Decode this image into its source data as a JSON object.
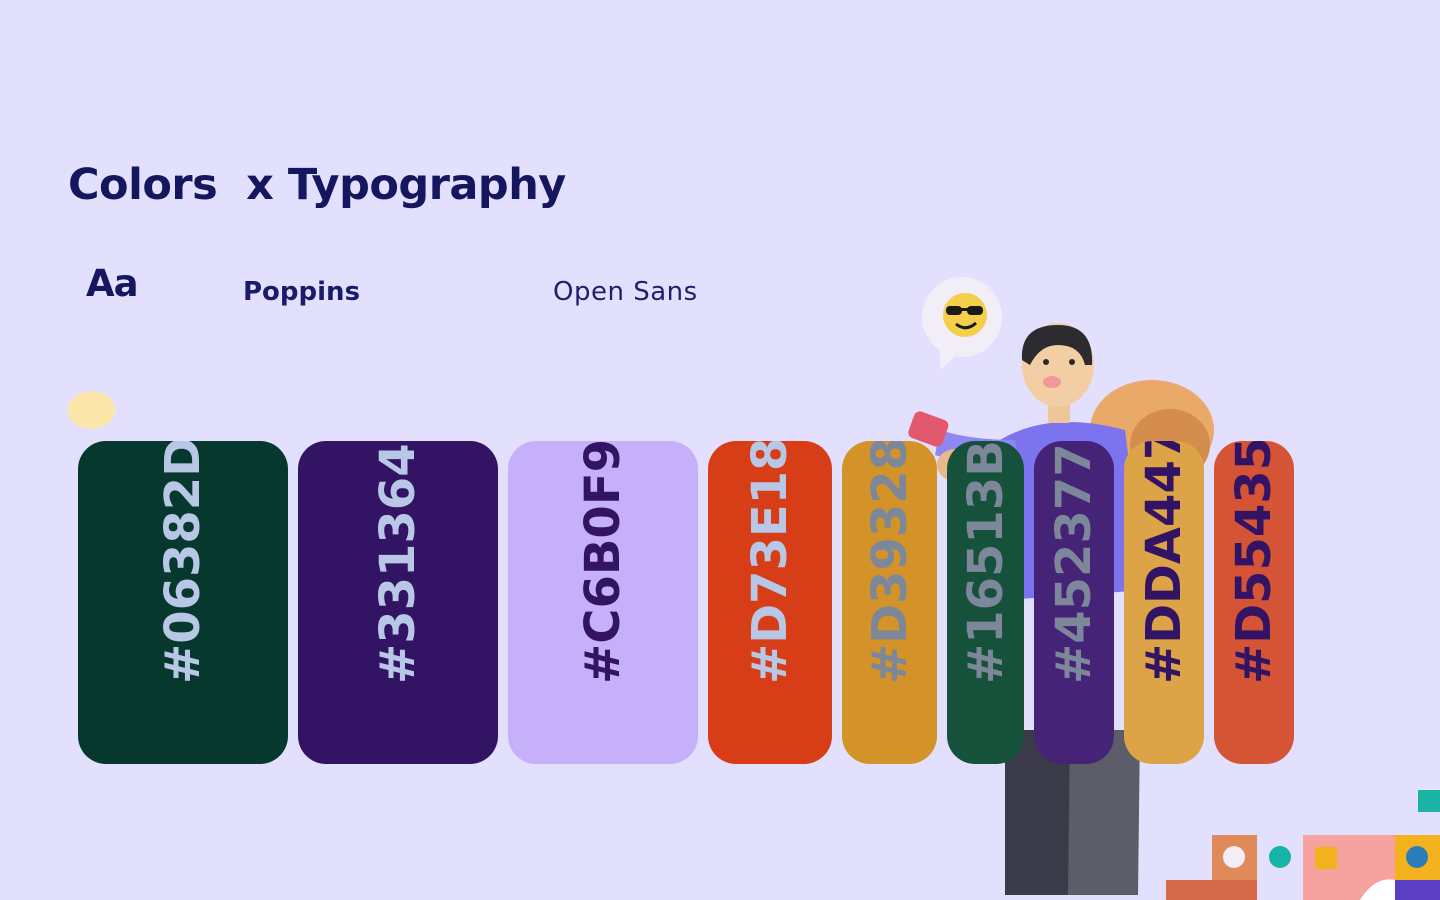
{
  "heading": {
    "title": "Colors  x Typography"
  },
  "typography": {
    "sample": "Aa",
    "primary_font": "Poppins",
    "secondary_font": "Open Sans"
  },
  "palette": [
    {
      "hex": "#06382D",
      "color": "#06382d",
      "label_color": "#b9c7e6"
    },
    {
      "hex": "#331364",
      "color": "#331364",
      "label_color": "#b9c7e6"
    },
    {
      "hex": "#C6B0F9",
      "color": "#c6b0f9",
      "label_color": "#331364"
    },
    {
      "hex": "#D73E18",
      "color": "#d73e18",
      "label_color": "#b9c7e6"
    },
    {
      "hex": "#D39328",
      "color": "#d39328",
      "label_color": "#7c879a"
    },
    {
      "hex": "#16513B",
      "color": "#16513b",
      "label_color": "#7c879a"
    },
    {
      "hex": "#452377",
      "color": "#452377",
      "label_color": "#7c879a"
    },
    {
      "hex": "#DDA447",
      "color": "#dda447",
      "label_color": "#331364"
    },
    {
      "hex": "#D55435",
      "color": "#d55435",
      "label_color": "#331364"
    }
  ],
  "icons": {
    "emoji": "sunglasses-emoji-icon",
    "illustration": "person-with-phone-illustration"
  },
  "colors": {
    "background": "#e3e0fe",
    "heading": "#14165e"
  }
}
